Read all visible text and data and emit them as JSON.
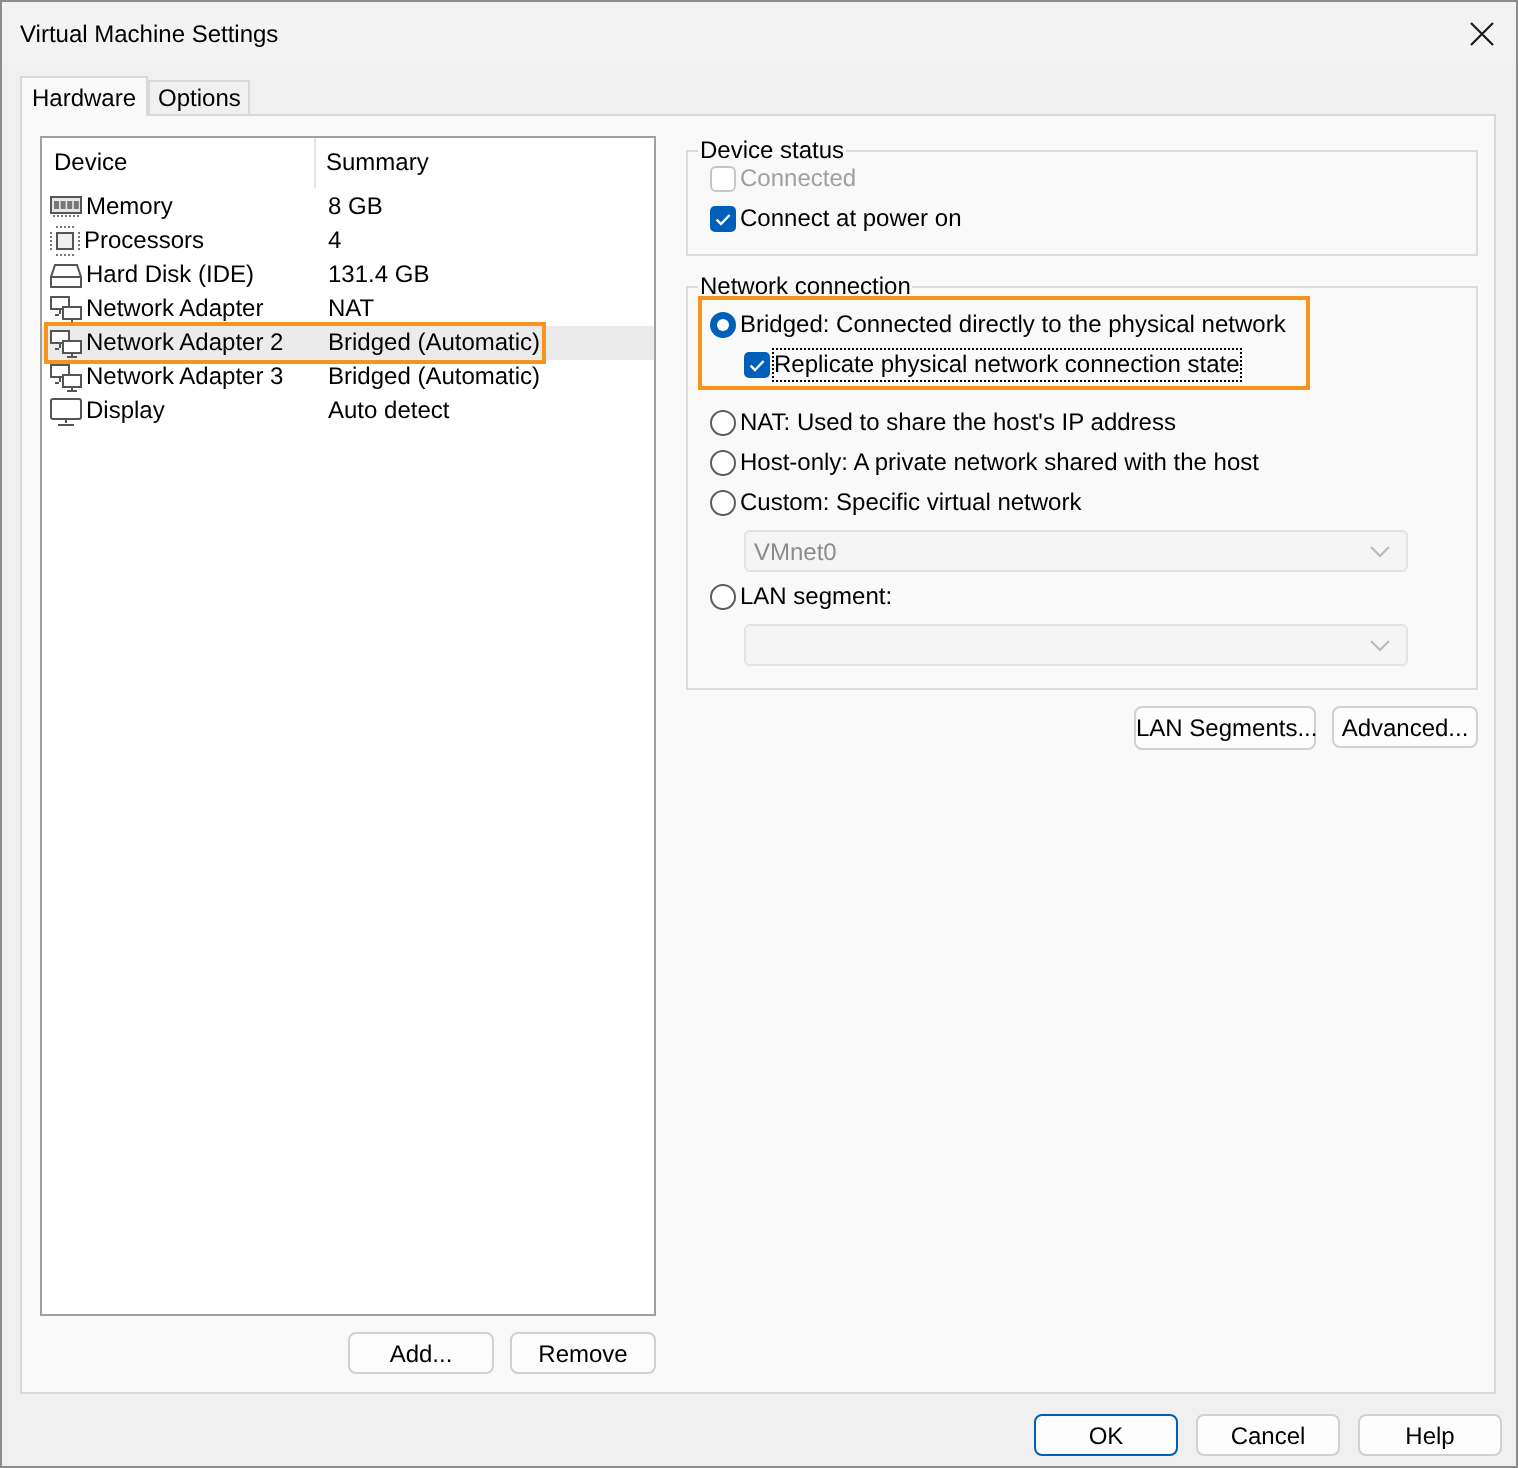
{
  "window": {
    "title": "Virtual Machine Settings"
  },
  "tabs": [
    {
      "label": "Hardware",
      "selected": true
    },
    {
      "label": "Options",
      "selected": false
    }
  ],
  "device_list": {
    "columns": [
      "Device",
      "Summary"
    ],
    "rows": [
      {
        "kind": "memory",
        "device": "Memory",
        "summary": "8 GB",
        "selected": false,
        "highlighted": false
      },
      {
        "kind": "processor",
        "device": "Processors",
        "summary": "4",
        "selected": false,
        "highlighted": false
      },
      {
        "kind": "hard_disk",
        "device": "Hard Disk (IDE)",
        "summary": "131.4 GB",
        "selected": false,
        "highlighted": false
      },
      {
        "kind": "network",
        "device": "Network Adapter",
        "summary": "NAT",
        "selected": false,
        "highlighted": false
      },
      {
        "kind": "network",
        "device": "Network Adapter 2",
        "summary": "Bridged (Automatic)",
        "selected": true,
        "highlighted": true
      },
      {
        "kind": "network",
        "device": "Network Adapter 3",
        "summary": "Bridged (Automatic)",
        "selected": false,
        "highlighted": false
      },
      {
        "kind": "display",
        "device": "Display",
        "summary": "Auto detect",
        "selected": false,
        "highlighted": false
      }
    ]
  },
  "device_buttons": [
    "Add...",
    "Remove"
  ],
  "device_status": {
    "title": "Device status",
    "options": [
      {
        "label": "Connected",
        "checked": false,
        "disabled": true
      },
      {
        "label": "Connect at power on",
        "checked": true,
        "disabled": false
      }
    ]
  },
  "network_connection": {
    "title": "Network connection",
    "options": [
      {
        "label": "Bridged: Connected directly to the physical network",
        "selected": true,
        "highlighted": true,
        "sub_option": {
          "label": "Replicate physical network connection state",
          "checked": true,
          "focused": true
        }
      },
      {
        "label": "NAT: Used to share the host's IP address",
        "selected": false,
        "highlighted": false
      },
      {
        "label": "Host-only: A private network shared with the host",
        "selected": false,
        "highlighted": false
      },
      {
        "label": "Custom: Specific virtual network",
        "selected": false,
        "highlighted": false,
        "dropdown": {
          "value": "VMnet0",
          "disabled": true
        }
      },
      {
        "label": "LAN segment:",
        "selected": false,
        "highlighted": false,
        "dropdown": {
          "disabled": true
        }
      }
    ]
  },
  "network_buttons": [
    "LAN Segments...",
    "Advanced..."
  ],
  "dialog_buttons": [
    {
      "label": "OK",
      "default": true
    },
    {
      "label": "Cancel",
      "default": false
    },
    {
      "label": "Help",
      "default": false
    }
  ]
}
